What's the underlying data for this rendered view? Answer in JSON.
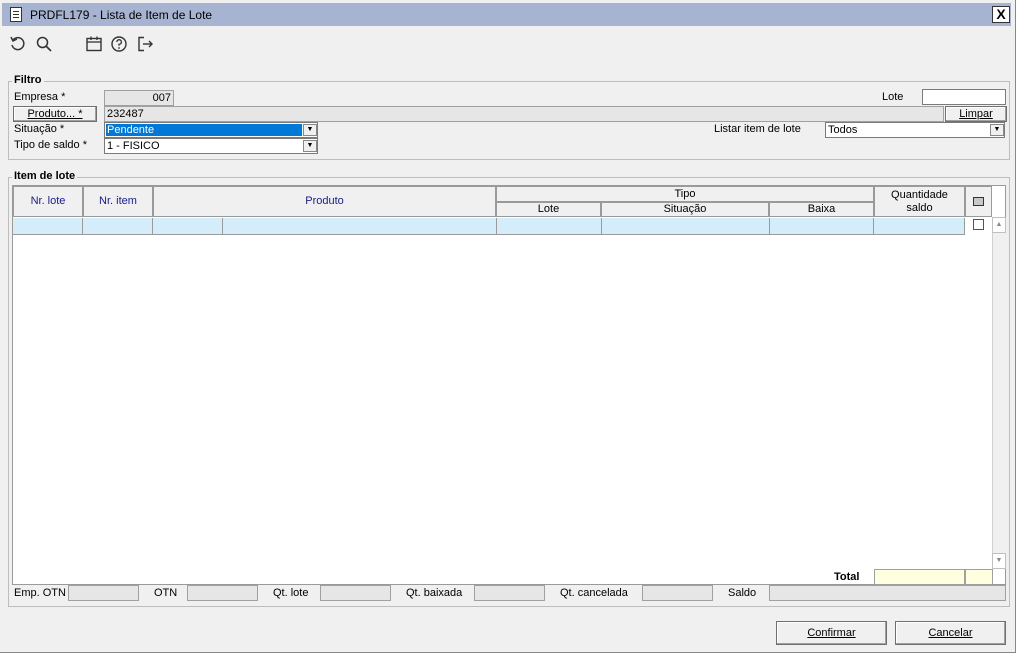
{
  "window": {
    "title": "PRDFL179 - Lista de Item de Lote",
    "close_label": "X"
  },
  "toolbar": {
    "icons": [
      "refresh-icon",
      "search-icon",
      "calendar-icon",
      "help-icon",
      "exit-icon"
    ]
  },
  "filtro": {
    "title": "Filtro",
    "empresa_label": "Empresa *",
    "empresa_value": "007",
    "produto_button": "Produto... *",
    "produto_value": "232487",
    "situacao_label": "Situação *",
    "situacao_value": "Pendente",
    "tipo_saldo_label": "Tipo de saldo *",
    "tipo_saldo_value": "1 - FISICO",
    "lote_label": "Lote",
    "lote_value": "",
    "limpar_button": "Limpar",
    "listar_label": "Listar item de lote",
    "listar_value": "Todos"
  },
  "itens": {
    "title": "Item de lote",
    "columns": {
      "nr_lote": "Nr. lote",
      "nr_item": "Nr. item",
      "produto": "Produto",
      "tipo": "Tipo",
      "lote": "Lote",
      "situacao": "Situação",
      "baixa": "Baixa",
      "quantidade_l1": "Quantidade",
      "quantidade_l2": "saldo"
    },
    "total_label": "Total"
  },
  "footer": {
    "emp_otn": "Emp. OTN",
    "otn": "OTN",
    "qt_lote": "Qt. lote",
    "qt_baixada": "Qt. baixada",
    "qt_cancelada": "Qt. cancelada",
    "saldo": "Saldo"
  },
  "buttons": {
    "confirmar": "Confirmar",
    "cancelar": "Cancelar"
  },
  "colors": {
    "titlebar": "#a6b4d1",
    "selection": "#0078d7",
    "row_highlight": "#d5ecfb",
    "total_field": "#ffffe0",
    "header_text": "#1a1a8c"
  }
}
